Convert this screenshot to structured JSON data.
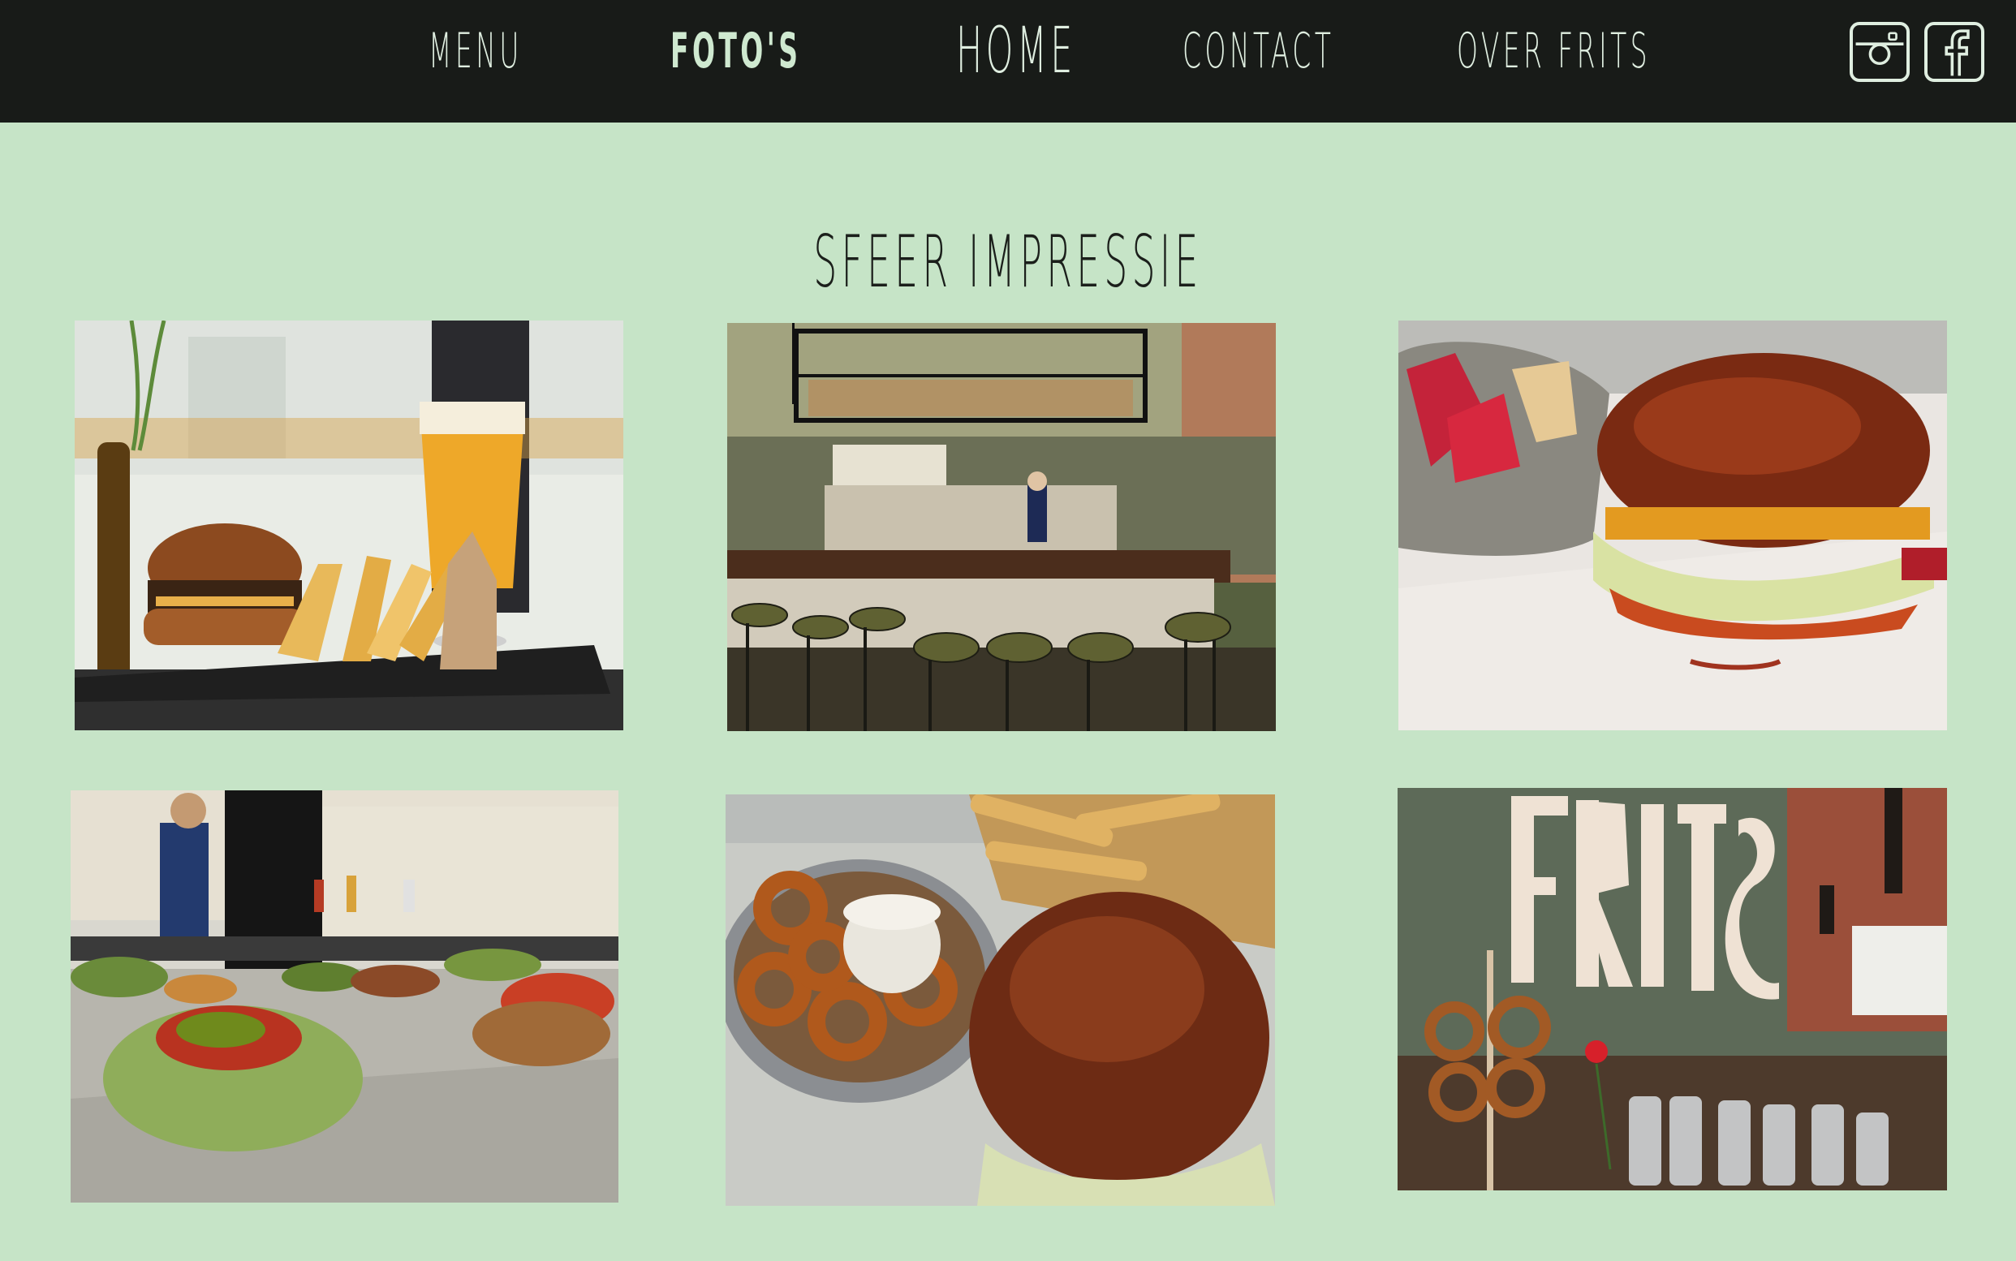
{
  "nav": {
    "menu": "MENU",
    "fotos": "FOTO'S",
    "home": "HOME",
    "contact": "CONTACT",
    "over": "OVER FRITS"
  },
  "social": {
    "instagram_icon": "instagram-icon",
    "facebook_icon": "facebook-icon"
  },
  "page_title": "SFEER IMPRESSIE",
  "photos": [
    {
      "subject": "burger-fries-beer"
    },
    {
      "subject": "bar-interior"
    },
    {
      "subject": "burger-closeup"
    },
    {
      "subject": "kitchen-burgers"
    },
    {
      "subject": "burger-onion-rings"
    },
    {
      "subject": "frits-sign-pretzels"
    }
  ],
  "colors": {
    "background": "#c6e4c7",
    "topbar": "#181b18",
    "nav_text": "#dfeee0"
  }
}
